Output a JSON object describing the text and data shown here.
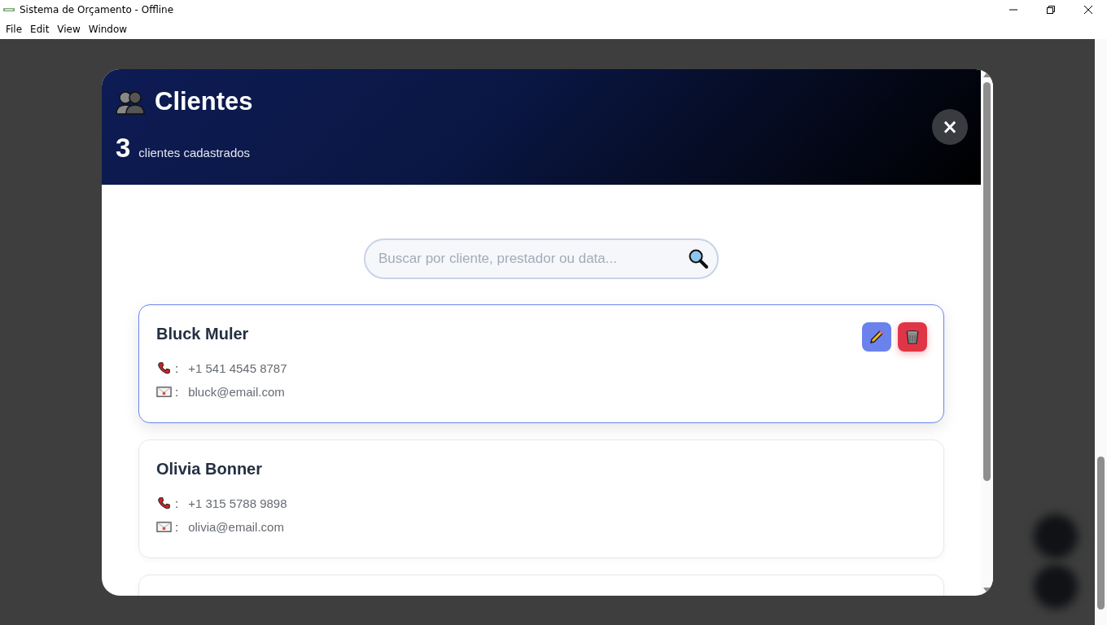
{
  "window": {
    "title": "Sistema de Orçamento - Offline"
  },
  "menu": [
    "File",
    "Edit",
    "View",
    "Window"
  ],
  "modal": {
    "title": "Clientes",
    "count": "3",
    "count_label": "clientes cadastrados",
    "close": "×"
  },
  "search": {
    "placeholder": "Buscar por cliente, prestador ou data..."
  },
  "clients": [
    {
      "name": "Bluck Muler",
      "phone_separator": ":",
      "phone": "+1 541 4545 8787",
      "email_separator": ":",
      "email": "bluck@email.com",
      "selected": true
    },
    {
      "name": "Olivia Bonner",
      "phone_separator": ":",
      "phone": "+1 315 5788 9898",
      "email_separator": ":",
      "email": "olivia@email.com",
      "selected": false
    }
  ]
}
